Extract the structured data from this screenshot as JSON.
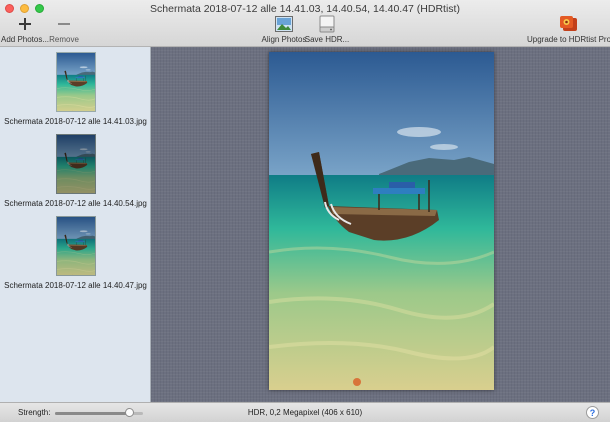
{
  "window": {
    "title": "Schermata 2018-07-12 alle 14.41.03, 14.40.54, 14.40.47 (HDRtist)"
  },
  "toolbar": {
    "add_label": "Add Photos...",
    "add_icon": "plus-icon",
    "remove_label": "Remove",
    "remove_icon": "minus-icon",
    "align_label": "Align Photos",
    "align_icon": "photo-icon",
    "save_label": "Save HDR...",
    "save_icon": "disk-icon",
    "upgrade_label": "Upgrade to HDRtist Pro",
    "upgrade_icon": "hdrtist-pro-icon"
  },
  "sidebar": {
    "items": [
      {
        "label": "Schermata 2018-07-12 alle 14.41.03.jpg"
      },
      {
        "label": "Schermata 2018-07-12 alle 14.40.54.jpg"
      },
      {
        "label": "Schermata 2018-07-12 alle 14.40.47.jpg"
      }
    ]
  },
  "statusbar": {
    "strength_label": "Strength:",
    "strength_value": 0.85,
    "info": "HDR, 0,2 Megapixel (406 x 610)",
    "help_label": "?"
  },
  "colors": {
    "sidebar_bg": "#dde5ee",
    "canvas_bg": "#6c7080",
    "help_accent": "#2a6de0"
  }
}
